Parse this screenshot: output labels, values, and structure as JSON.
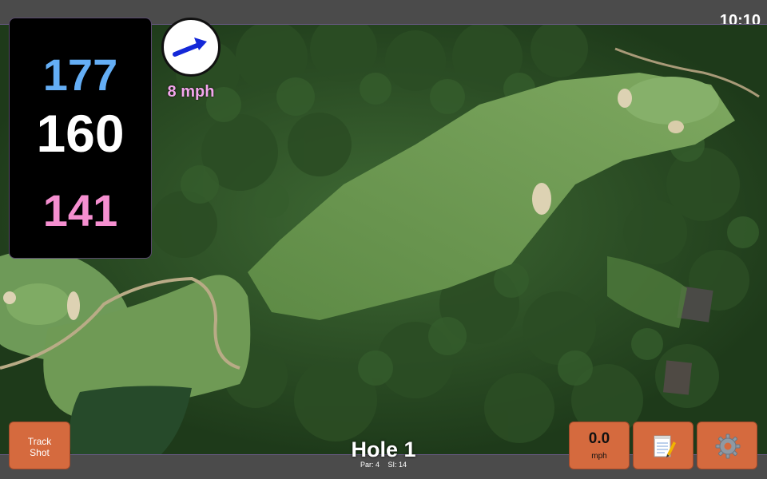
{
  "status": {
    "time": "10:10"
  },
  "distances": {
    "back": "177",
    "middle": "160",
    "front": "141"
  },
  "wind": {
    "speed": "8 mph",
    "icon": "wind-arrow-icon"
  },
  "hole": {
    "title": "Hole 1",
    "par": "Par: 4",
    "stroke_index": "SI: 14"
  },
  "buttons": {
    "track_shot": "Track\nShot",
    "speed_value": "0.0",
    "speed_unit": "mph",
    "notes_icon": "notepad-icon",
    "settings_icon": "gear-icon"
  },
  "colors": {
    "back_distance": "#64aef5",
    "middle_distance": "#ffffff",
    "front_distance": "#f58fd0",
    "wind_text": "#f3a6ec",
    "button": "#d56a3e",
    "bar": "#4b4b4b"
  }
}
